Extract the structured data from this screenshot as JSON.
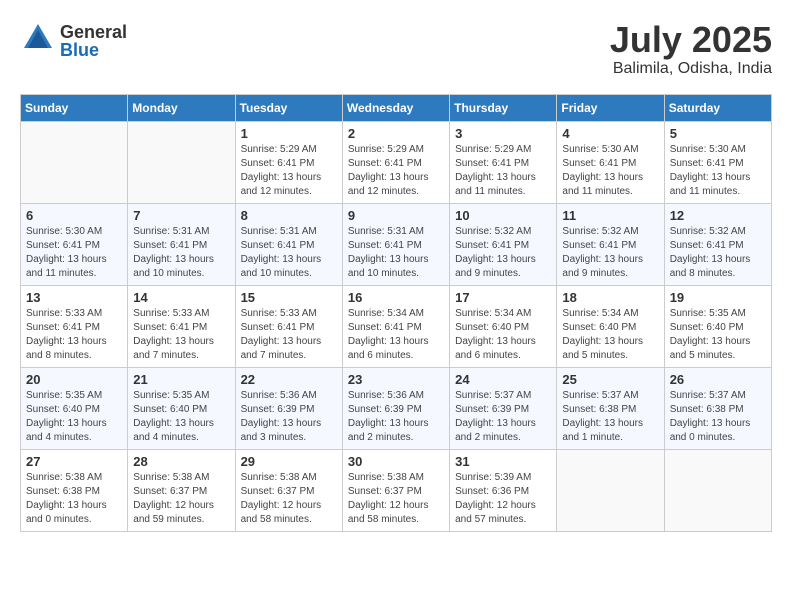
{
  "header": {
    "logo_general": "General",
    "logo_blue": "Blue",
    "month": "July 2025",
    "location": "Balimila, Odisha, India"
  },
  "days_of_week": [
    "Sunday",
    "Monday",
    "Tuesday",
    "Wednesday",
    "Thursday",
    "Friday",
    "Saturday"
  ],
  "weeks": [
    [
      {
        "day": "",
        "info": ""
      },
      {
        "day": "",
        "info": ""
      },
      {
        "day": "1",
        "info": "Sunrise: 5:29 AM\nSunset: 6:41 PM\nDaylight: 13 hours and 12 minutes."
      },
      {
        "day": "2",
        "info": "Sunrise: 5:29 AM\nSunset: 6:41 PM\nDaylight: 13 hours and 12 minutes."
      },
      {
        "day": "3",
        "info": "Sunrise: 5:29 AM\nSunset: 6:41 PM\nDaylight: 13 hours and 11 minutes."
      },
      {
        "day": "4",
        "info": "Sunrise: 5:30 AM\nSunset: 6:41 PM\nDaylight: 13 hours and 11 minutes."
      },
      {
        "day": "5",
        "info": "Sunrise: 5:30 AM\nSunset: 6:41 PM\nDaylight: 13 hours and 11 minutes."
      }
    ],
    [
      {
        "day": "6",
        "info": "Sunrise: 5:30 AM\nSunset: 6:41 PM\nDaylight: 13 hours and 11 minutes."
      },
      {
        "day": "7",
        "info": "Sunrise: 5:31 AM\nSunset: 6:41 PM\nDaylight: 13 hours and 10 minutes."
      },
      {
        "day": "8",
        "info": "Sunrise: 5:31 AM\nSunset: 6:41 PM\nDaylight: 13 hours and 10 minutes."
      },
      {
        "day": "9",
        "info": "Sunrise: 5:31 AM\nSunset: 6:41 PM\nDaylight: 13 hours and 10 minutes."
      },
      {
        "day": "10",
        "info": "Sunrise: 5:32 AM\nSunset: 6:41 PM\nDaylight: 13 hours and 9 minutes."
      },
      {
        "day": "11",
        "info": "Sunrise: 5:32 AM\nSunset: 6:41 PM\nDaylight: 13 hours and 9 minutes."
      },
      {
        "day": "12",
        "info": "Sunrise: 5:32 AM\nSunset: 6:41 PM\nDaylight: 13 hours and 8 minutes."
      }
    ],
    [
      {
        "day": "13",
        "info": "Sunrise: 5:33 AM\nSunset: 6:41 PM\nDaylight: 13 hours and 8 minutes."
      },
      {
        "day": "14",
        "info": "Sunrise: 5:33 AM\nSunset: 6:41 PM\nDaylight: 13 hours and 7 minutes."
      },
      {
        "day": "15",
        "info": "Sunrise: 5:33 AM\nSunset: 6:41 PM\nDaylight: 13 hours and 7 minutes."
      },
      {
        "day": "16",
        "info": "Sunrise: 5:34 AM\nSunset: 6:41 PM\nDaylight: 13 hours and 6 minutes."
      },
      {
        "day": "17",
        "info": "Sunrise: 5:34 AM\nSunset: 6:40 PM\nDaylight: 13 hours and 6 minutes."
      },
      {
        "day": "18",
        "info": "Sunrise: 5:34 AM\nSunset: 6:40 PM\nDaylight: 13 hours and 5 minutes."
      },
      {
        "day": "19",
        "info": "Sunrise: 5:35 AM\nSunset: 6:40 PM\nDaylight: 13 hours and 5 minutes."
      }
    ],
    [
      {
        "day": "20",
        "info": "Sunrise: 5:35 AM\nSunset: 6:40 PM\nDaylight: 13 hours and 4 minutes."
      },
      {
        "day": "21",
        "info": "Sunrise: 5:35 AM\nSunset: 6:40 PM\nDaylight: 13 hours and 4 minutes."
      },
      {
        "day": "22",
        "info": "Sunrise: 5:36 AM\nSunset: 6:39 PM\nDaylight: 13 hours and 3 minutes."
      },
      {
        "day": "23",
        "info": "Sunrise: 5:36 AM\nSunset: 6:39 PM\nDaylight: 13 hours and 2 minutes."
      },
      {
        "day": "24",
        "info": "Sunrise: 5:37 AM\nSunset: 6:39 PM\nDaylight: 13 hours and 2 minutes."
      },
      {
        "day": "25",
        "info": "Sunrise: 5:37 AM\nSunset: 6:38 PM\nDaylight: 13 hours and 1 minute."
      },
      {
        "day": "26",
        "info": "Sunrise: 5:37 AM\nSunset: 6:38 PM\nDaylight: 13 hours and 0 minutes."
      }
    ],
    [
      {
        "day": "27",
        "info": "Sunrise: 5:38 AM\nSunset: 6:38 PM\nDaylight: 13 hours and 0 minutes."
      },
      {
        "day": "28",
        "info": "Sunrise: 5:38 AM\nSunset: 6:37 PM\nDaylight: 12 hours and 59 minutes."
      },
      {
        "day": "29",
        "info": "Sunrise: 5:38 AM\nSunset: 6:37 PM\nDaylight: 12 hours and 58 minutes."
      },
      {
        "day": "30",
        "info": "Sunrise: 5:38 AM\nSunset: 6:37 PM\nDaylight: 12 hours and 58 minutes."
      },
      {
        "day": "31",
        "info": "Sunrise: 5:39 AM\nSunset: 6:36 PM\nDaylight: 12 hours and 57 minutes."
      },
      {
        "day": "",
        "info": ""
      },
      {
        "day": "",
        "info": ""
      }
    ]
  ]
}
